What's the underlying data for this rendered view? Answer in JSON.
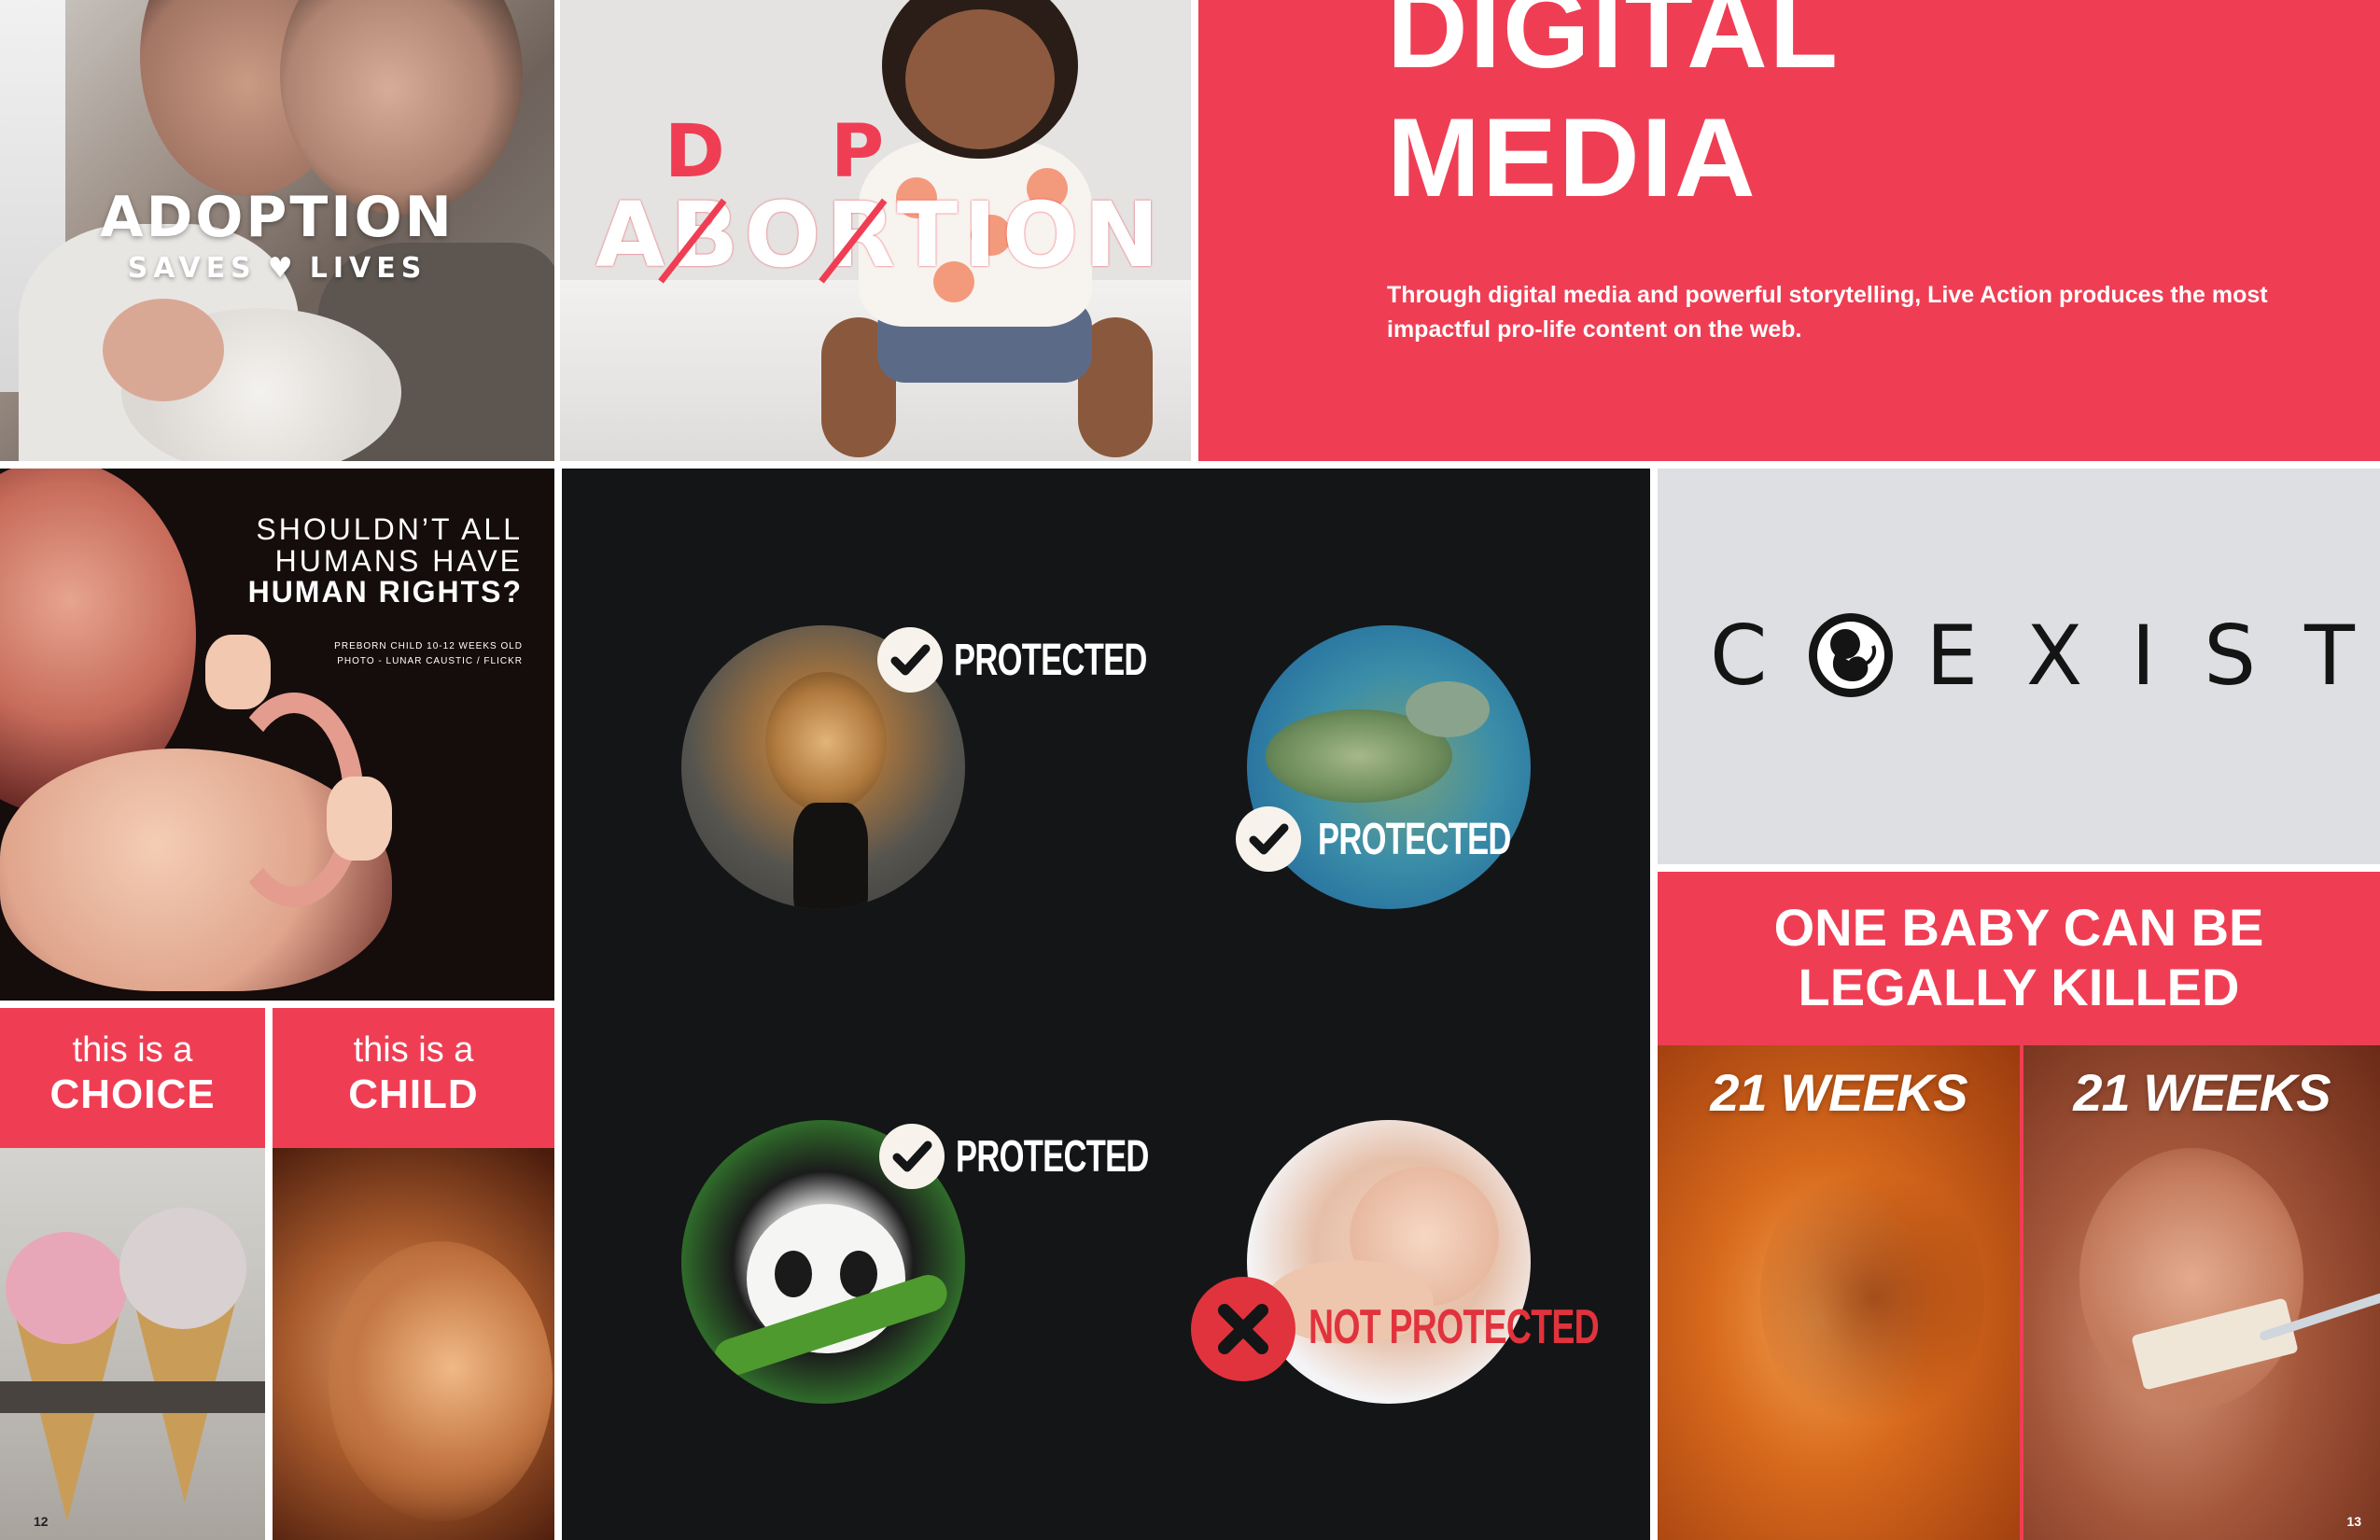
{
  "adoption": {
    "title": "ADOPTION",
    "tagline_left": "SAVES",
    "tagline_heart": "♥",
    "tagline_right": "LIVES"
  },
  "wordplay": {
    "base_word": "ABORTION",
    "replacement_letter_1": "D",
    "replacement_letter_2": "P",
    "accent_color": "#ef3e54"
  },
  "digital_media": {
    "title_line1": "DIGITAL",
    "title_line2": "MEDIA",
    "body": "Through digital media and powerful storytelling, Live Action produces the most impactful pro-life content on the web.",
    "background_color": "#ef3e54"
  },
  "human_rights": {
    "line1": "SHOULDN’T ALL",
    "line2": "HUMANS HAVE",
    "line3": "HUMAN RIGHTS?",
    "caption1": "PREBORN CHILD 10-12 WEEKS OLD",
    "caption2": "PHOTO - LUNAR CAUSTIC / FLICKR"
  },
  "choice_tile": {
    "small": "this is a",
    "big": "CHOICE",
    "page_number": "12"
  },
  "child_tile": {
    "small": "this is a",
    "big": "CHILD"
  },
  "protected": {
    "items": [
      {
        "subject": "lion",
        "label": "PROTECTED",
        "status": "protected",
        "icon": "check-icon"
      },
      {
        "subject": "sea turtle",
        "label": "PROTECTED",
        "status": "protected",
        "icon": "check-icon"
      },
      {
        "subject": "panda",
        "label": "PROTECTED",
        "status": "protected",
        "icon": "check-icon"
      },
      {
        "subject": "baby",
        "label": "NOT PROTECTED",
        "status": "not-protected",
        "icon": "x-icon"
      }
    ],
    "background_color": "#141516",
    "not_protected_color": "#e1333d"
  },
  "coexist": {
    "letter_c": "C",
    "letters_rest": "EXIST",
    "o_replacement_icon": "fetus-icon"
  },
  "weeks": {
    "title_line1": "ONE BABY CAN BE",
    "title_line2": "LEGALLY KILLED",
    "left_label": "21 WEEKS",
    "right_label": "21 WEEKS",
    "page_number": "13"
  }
}
